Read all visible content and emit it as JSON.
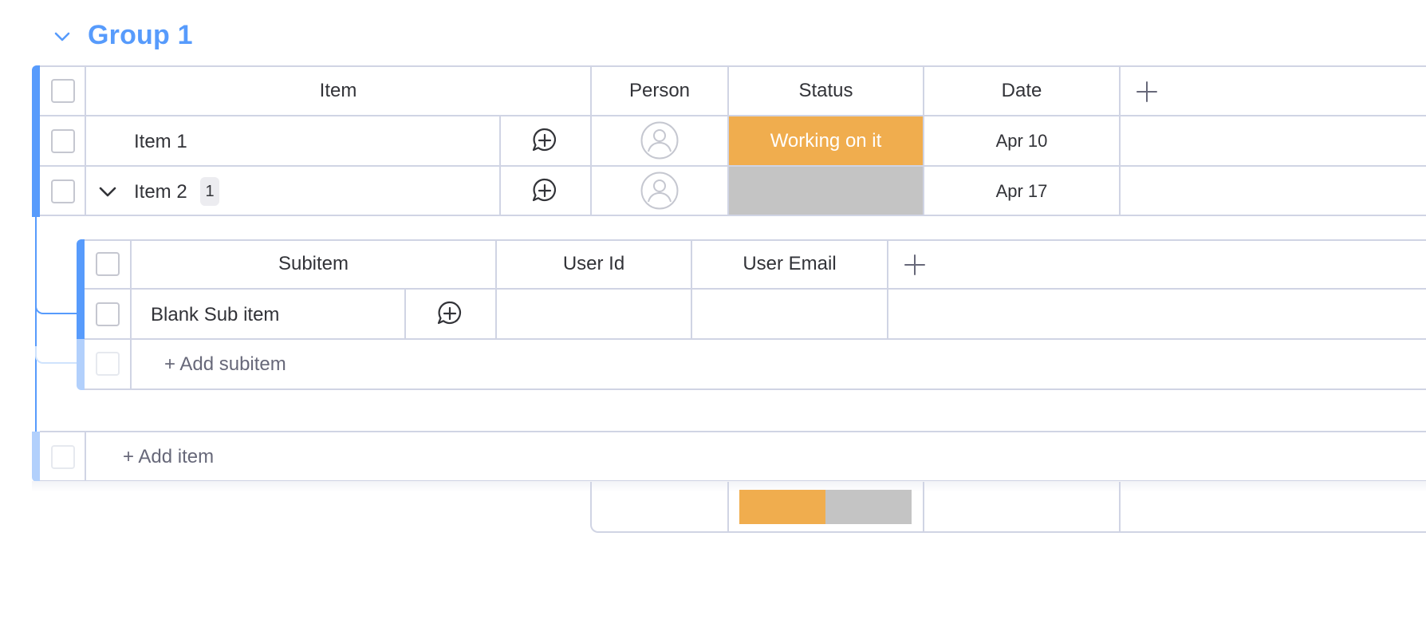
{
  "group": {
    "title": "Group 1"
  },
  "main": {
    "columns": {
      "item": "Item",
      "person": "Person",
      "status": "Status",
      "date": "Date"
    },
    "rows": [
      {
        "name": "Item 1",
        "status": "Working on it",
        "date": "Apr 10"
      },
      {
        "name": "Item 2",
        "subitem_count": "1",
        "status": "",
        "date": "Apr 17"
      }
    ],
    "add_item": "+ Add item"
  },
  "subitems": {
    "columns": {
      "subitem": "Subitem",
      "user_id": "User Id",
      "user_email": "User Email"
    },
    "rows": [
      {
        "name": "Blank Sub item"
      }
    ],
    "add_subitem": "+ Add subitem"
  },
  "summary": {
    "status_distribution": {
      "working_on_it": 0.5,
      "empty": 0.5
    }
  },
  "colors": {
    "accent": "#579bfc",
    "working_on_it": "#f0ad4e",
    "empty_status": "#c4c4c4",
    "border": "#d0d4e4"
  }
}
